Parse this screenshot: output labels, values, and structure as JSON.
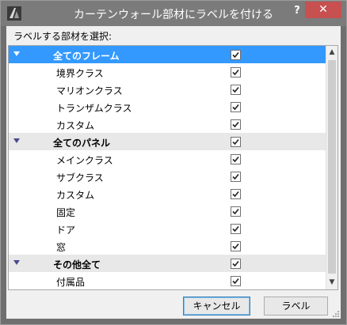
{
  "window": {
    "title": "カーテンウォール部材にラベルを付ける",
    "help_glyph": "?",
    "close_glyph": "✕"
  },
  "prompt": "ラベルする部材を選択:",
  "list": {
    "rows": [
      {
        "kind": "group",
        "label": "全てのフレーム",
        "checked": true,
        "selected": true
      },
      {
        "kind": "item",
        "label": "境界クラス",
        "checked": true
      },
      {
        "kind": "item",
        "label": "マリオンクラス",
        "checked": true
      },
      {
        "kind": "item",
        "label": "トランザムクラス",
        "checked": true
      },
      {
        "kind": "item",
        "label": "カスタム",
        "checked": true
      },
      {
        "kind": "group",
        "label": "全てのパネル",
        "checked": true
      },
      {
        "kind": "item",
        "label": "メインクラス",
        "checked": true
      },
      {
        "kind": "item",
        "label": "サブクラス",
        "checked": true
      },
      {
        "kind": "item",
        "label": "カスタム",
        "checked": true
      },
      {
        "kind": "item",
        "label": "固定",
        "checked": true
      },
      {
        "kind": "item",
        "label": "ドア",
        "checked": true
      },
      {
        "kind": "item",
        "label": "窓",
        "checked": true
      },
      {
        "kind": "group",
        "label": "その他全て",
        "checked": true
      },
      {
        "kind": "item",
        "label": "付属品",
        "checked": true
      }
    ]
  },
  "buttons": {
    "cancel": "キャンセル",
    "label": "ラベル"
  },
  "scroll": {
    "up_glyph": "▲",
    "down_glyph": "▼"
  }
}
